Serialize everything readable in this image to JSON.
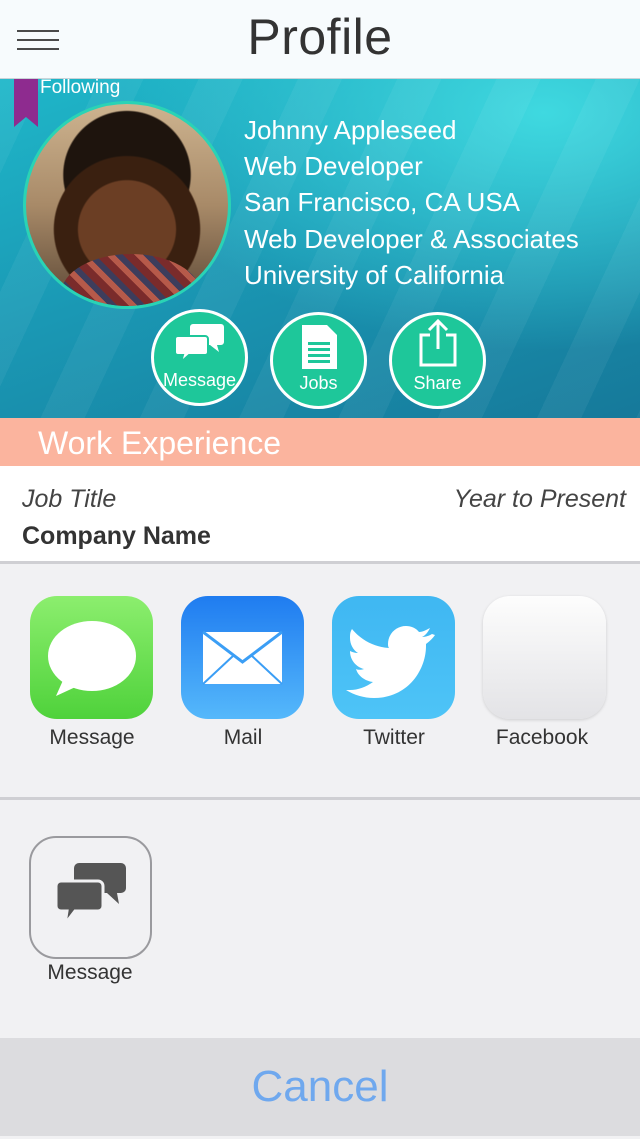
{
  "header": {
    "title": "Profile",
    "menu_icon": "hamburger-menu-icon"
  },
  "profile": {
    "badge": "Following",
    "name": "Johnny Appleseed",
    "role": "Web Developer",
    "location": "San Francisco, CA  USA",
    "company": "Web Developer & Associates",
    "school": "University of California",
    "actions": [
      {
        "label": "Message",
        "icon": "chat-bubbles-icon"
      },
      {
        "label": "Jobs",
        "icon": "document-icon"
      },
      {
        "label": "Share",
        "icon": "share-icon"
      }
    ]
  },
  "work": {
    "section_title": "Work Experience",
    "job_title": "Job Title",
    "period": "Year to Present",
    "company": "Company Name"
  },
  "share_sheet": {
    "apps": [
      {
        "label": "Message",
        "icon": "messages-app-icon"
      },
      {
        "label": "Mail",
        "icon": "mail-app-icon"
      },
      {
        "label": "Twitter",
        "icon": "twitter-app-icon"
      },
      {
        "label": "Facebook",
        "icon": "facebook-app-icon"
      }
    ],
    "actions": [
      {
        "label": "Message",
        "icon": "chat-bubbles-icon"
      }
    ],
    "cancel": "Cancel"
  },
  "colors": {
    "accent_green": "#1ec79a",
    "work_header": "#fbb49e",
    "cancel_text": "#6fa8ee",
    "bookmark": "#8e2b8f"
  }
}
